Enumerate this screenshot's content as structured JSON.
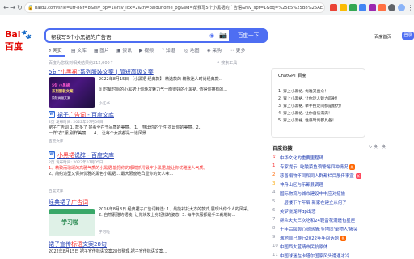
{
  "browser": {
    "url": "baidu.com/s?ie=utf-8&f=8&rsv_bp=1&rsv_idx=2&tn=baiduhome_pg&wd=帮我写5个小黑裙的广告语&rsv_spt=1&oq=%25E5%25B8%25AE..."
  },
  "header": {
    "logo_bai": "Bai",
    "logo_paw": "🐾",
    "logo_du": "百度",
    "search_value": "帮我写5个小黑裙的广告语",
    "search_button": "百度一下",
    "link_settings": "百度首页",
    "link_login_text": "设置",
    "login_button": "登录"
  },
  "tabs": [
    {
      "label": "网页",
      "icon": "search-icon"
    },
    {
      "label": "文库",
      "icon": "wenku-icon"
    },
    {
      "label": "图片",
      "icon": "image-icon"
    },
    {
      "label": "资讯",
      "icon": "news-icon"
    },
    {
      "label": "视频",
      "icon": "video-icon"
    },
    {
      "label": "知道",
      "icon": "zhidao-icon"
    },
    {
      "label": "地图",
      "icon": "map-icon"
    },
    {
      "label": "采购",
      "icon": "buy-icon"
    },
    {
      "label": "更多",
      "icon": "more-icon"
    }
  ],
  "result_count": "百度为您找到相关结果约212,000个",
  "tools_label": "搜索工具",
  "results": [
    {
      "title_pre": "5句\"",
      "title_hl": "小黑裙",
      "title_post": "\"系列服装文案 | 简短高级文案",
      "date": "2022年8月15日",
      "text1": "2022年8月15日  【小黑裙 经典款】 精选款的 精致迷人时尚经典款...",
      "text2": "② 时髦时尚的小黑裙让你焕发魅力气一面很好的小黑裙, 值得你拥有的...",
      "source": "小红书",
      "thumb_line1": "5句 小黑裙",
      "thumb_line2": "系列服装文案",
      "thumb_line3": "简短高级文案"
    },
    {
      "title_pre": "裙子",
      "title_hl": "广告词",
      "title_post": " - 百度文库",
      "meta": "2页  发布时间: 2022年07月09日",
      "text1": "裙子广告词 1. 款多了 好看全在于品质的美丽。 1、 穿出你的个性,衣出你的美丽。2、",
      "text2": "一样\"衣\"服,别样美丽! ... 4、 让每个女孩都是一道风景...",
      "source": "百度文库"
    },
    {
      "title_pre": "",
      "title_hl": "小黑裙",
      "title_post": "说辞 - 百度文库",
      "meta": "2页  发布时间: 2022年07月05日",
      "text1": "1、精致而歌颂的高雅气质的小黑裙,能把你的眼睛抓得最牢小黑裙,能让你优雅迷人气质。",
      "text2": "2、简约造型又保持优雅的黑色小黑裙...  最大限度地凸显你的女人味...",
      "source": "百度文库"
    },
    {
      "title_pre": "经典裙子",
      "title_hl": "广告词",
      "title_post": "",
      "date": "2016年8月8日",
      "text1": "2016年8月8日  经典裙子广告词精选: 1、最能衬托大方的款式,展现出你个人的风采。",
      "text2": "2. 自然素雅的裙装, 让你焕发上身轻松的姿态! 3. 每件衣服都是手工裁制的...",
      "source": "学习啦",
      "thumb_text": "学习啦"
    },
    {
      "title_pre": "裙子宣传",
      "title_hl": "标语",
      "title_post": "文案28句",
      "date": "2022年8月15日",
      "text1": "2022年8月15日  裙子宣传标语文案28句整理,裙子宣传标语文案...",
      "text2": "",
      "source": ""
    }
  ],
  "ai_card": {
    "title": "ChatGPT 百度",
    "lines": [
      "1. 穿上小黑裙, 优雅又出众！",
      "2. 穿上小黑裙, 让你迷人魅力四射！",
      "3. 穿上小黑裙, 举手投足间都是魅力！",
      "4. 穿上小黑裙, 让你自信满满！",
      "5. 穿上小黑裙, 性感时尚都具备！"
    ]
  },
  "hot": {
    "title": "百度热搜",
    "refresh": "换一换",
    "items": [
      {
        "num": "",
        "text": "中华文化的重要里程碑",
        "badge": "",
        "num_color": "#f73131"
      },
      {
        "num": "1",
        "text": "专家提示: 吃酸菜鱼须警惕四种情况",
        "badge": "热",
        "num_color": "#f73131"
      },
      {
        "num": "2",
        "text": "慈善捐物不同和同人群都栏目展传事宜",
        "badge": "新",
        "num_color": "#ff6600"
      },
      {
        "num": "3",
        "text": "神舟山区与乐都县调理",
        "badge": "",
        "num_color": "#faa90e"
      },
      {
        "num": "4",
        "text": "国际物流与城市建设中中应对措施",
        "badge": "",
        "num_color": "#9195a3"
      },
      {
        "num": "5",
        "text": "一层楼下午年后 新家在建立从何了",
        "badge": "",
        "num_color": "#9195a3"
      },
      {
        "num": "6",
        "text": "美梦绕湖畔dp出悲",
        "badge": "",
        "num_color": "#9195a3"
      },
      {
        "num": "7",
        "text": "群众夫夫三次吃和24鞋雷花满造包星座",
        "badge": "",
        "num_color": "#9195a3"
      },
      {
        "num": "8",
        "text": "十年后回顾心灵感情:多地同'牵物人'隔突",
        "badge": "",
        "num_color": "#9195a3"
      },
      {
        "num": "9",
        "text": "满地自己游行2022年年间话题",
        "badge": "热",
        "num_color": "#9195a3"
      },
      {
        "num": "10",
        "text": "中国西大蓝晴市民抗原体",
        "badge": "",
        "num_color": "#9195a3"
      },
      {
        "num": "11",
        "text": "中国球迷在卡塔尔国家风头遭遇冰冷",
        "badge": "",
        "num_color": "#9195a3"
      }
    ]
  },
  "colors": {
    "accent": "#4e6ef2",
    "link": "#2440b3",
    "highlight": "#f73131"
  }
}
